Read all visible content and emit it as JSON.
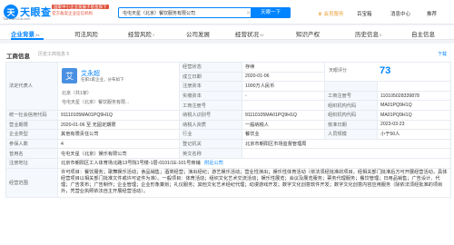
{
  "header": {
    "logo_mark": "天",
    "logo_text": "天眼查",
    "logo_sub": "TianYanCha.com",
    "gov_line1_badge": "国家中小企业发展子基金旗下",
    "gov_line2": "官方备案企业征信机构",
    "search_value": "屯屯天星（北京）餐饮服务有限公司",
    "search_button": "天眼一下",
    "vip": "会员服务",
    "links": [
      "百宝箱",
      "消息中心",
      "推荐"
    ]
  },
  "tabs": [
    {
      "label": "企业背景",
      "count": "24",
      "active": true
    },
    {
      "label": "司法风险",
      "count": ""
    },
    {
      "label": "经营风险",
      "count": "2"
    },
    {
      "label": "公司发展",
      "count": ""
    },
    {
      "label": "经营状况",
      "count": "35"
    },
    {
      "label": "知识产权",
      "count": ""
    },
    {
      "label": "历史信息",
      "count": "5"
    },
    {
      "label": "自主信息",
      "count": ""
    }
  ],
  "panel": {
    "title": "工商信息",
    "history": "历史工商信息 5",
    "note": "下载"
  },
  "rep": {
    "label": "法定代表人",
    "avatar": "艾",
    "name": "艾永超",
    "stats": "任职1家企业，分布如下",
    "line1": "北京（共1家）",
    "line2": "屯屯天星（北京）餐饮服务有限..."
  },
  "fields": {
    "status_lbl": "经营状态",
    "status": "存续",
    "found_lbl": "成立日期",
    "found": "2020-01-06",
    "reg_lbl": "注册资本",
    "reg": "1000万人民币",
    "paid_lbl": "实缴资本",
    "paid": "-",
    "eng_lbl": "工商注册号",
    "eng": "",
    "tax_lbl": "纳税人识别号",
    "tax": "91110105MA01PQ9H1Q",
    "org_lbl": "组织机构代码",
    "org": "MA01PQ9H1Q",
    "usc_lbl": "统一社会信用代码",
    "usc": "91110105MA01PQ9H1Q",
    "ins_lbl": "工商注册号",
    "ins": "110105028339878",
    "term_lbl": "营业期限",
    "term": "2020-01-06 至 无固定期限",
    "taxq_lbl": "纳税人资质",
    "taxq": "一般纳税人",
    "appr_lbl": "核准日期",
    "appr": "2023-03-23",
    "type_lbl": "企业类型",
    "type": "其他有限责任公司",
    "ind_lbl": "行业",
    "ind": "餐饮业",
    "size_lbl": "人员规模",
    "size": "小于50人",
    "ins2_lbl": "参保人数",
    "ins2": "4",
    "auth_lbl": "登记机关",
    "auth": "北京市朝阳区市场监督管理局",
    "used_lbl": "曾用名",
    "used": "屯屯天星（北京）娱乐有限公司",
    "eng2_lbl": "英文名称",
    "eng2": "",
    "addr_lbl": "注册地址",
    "addr": "北京市朝阳区工人体育场北路13号院1号楼-1层-0101/1E-101号商铺",
    "addr_more": "附近公司",
    "scope_lbl": "经营范围",
    "scope": "许可项目：餐饮服务；歌舞娱乐活动；食品销售；酒类经营；演出经纪；游艺娱乐活动；营业性演出；娱乐性体育活动（依法须经批准的项目，经相关部门批准后方可开展经营活动，具体经营项目以相关部门批准文件或许可证件为准）。一般项目：体育活动；组织文化艺术交流活动；娱乐性展览；会议及展览服务；票务代理服务；餐饮管理；日用品销售；广告设计、代理；广告发布；广告制作；企业管理；企业形象策划；礼仪服务；其他文化艺术经纪代理；动漫游戏开发；数字文化创意软件开发；数字文化创意内容应用服务（除依法须经批准的项目外，凭营业执照依法自主开展经营活动）。"
  },
  "score": {
    "label": "天眼评分",
    "value": "73"
  }
}
